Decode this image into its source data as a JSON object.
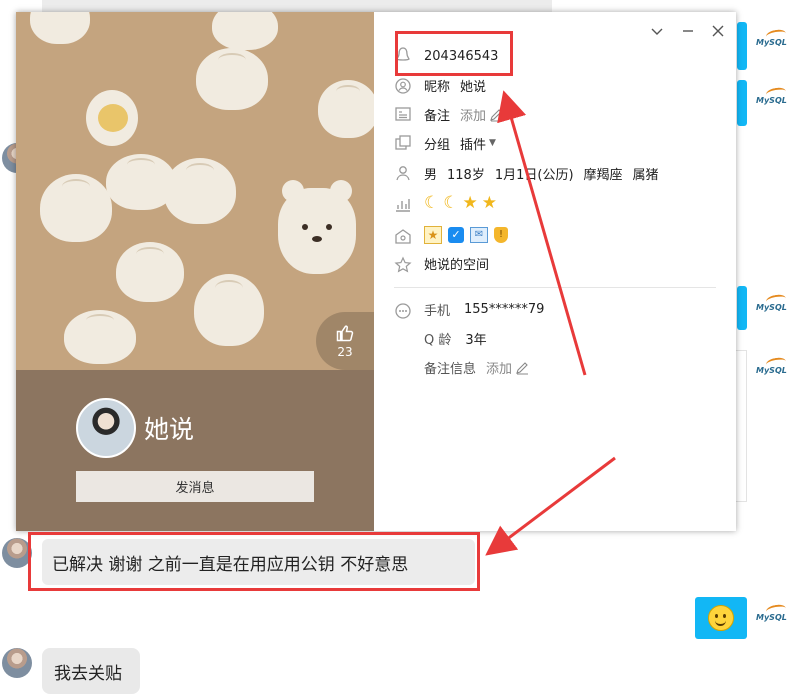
{
  "profile": {
    "qq_number": "204346543",
    "display_name": "她说",
    "send_message_label": "发消息",
    "likes": "23",
    "nickname_label": "昵称",
    "nickname": "她说",
    "remark_label": "备注",
    "remark_add": "添加",
    "group_label": "分组",
    "group_value": "插件",
    "gender": "男",
    "age": "118岁",
    "birthday": "1月1日(公历)",
    "zodiac": "摩羯座",
    "chinese_zodiac": "属猪",
    "space_link": "她说的空间",
    "phone_label": "手机",
    "phone": "155******79",
    "q_age_label": "Q 龄",
    "q_age": "3年",
    "remark_info_label": "备注信息",
    "remark_info_add": "添加"
  },
  "chat": {
    "messages": [
      {
        "text": "已解决  谢谢  之前一直是在用应用公钥 不好意思"
      },
      {
        "text": "我去关贴"
      }
    ]
  },
  "colors": {
    "accent_blue": "#12b7f5",
    "annotation_red": "#e83a3a",
    "card_tan": "#c4a47f",
    "card_brown": "#8c7560"
  }
}
